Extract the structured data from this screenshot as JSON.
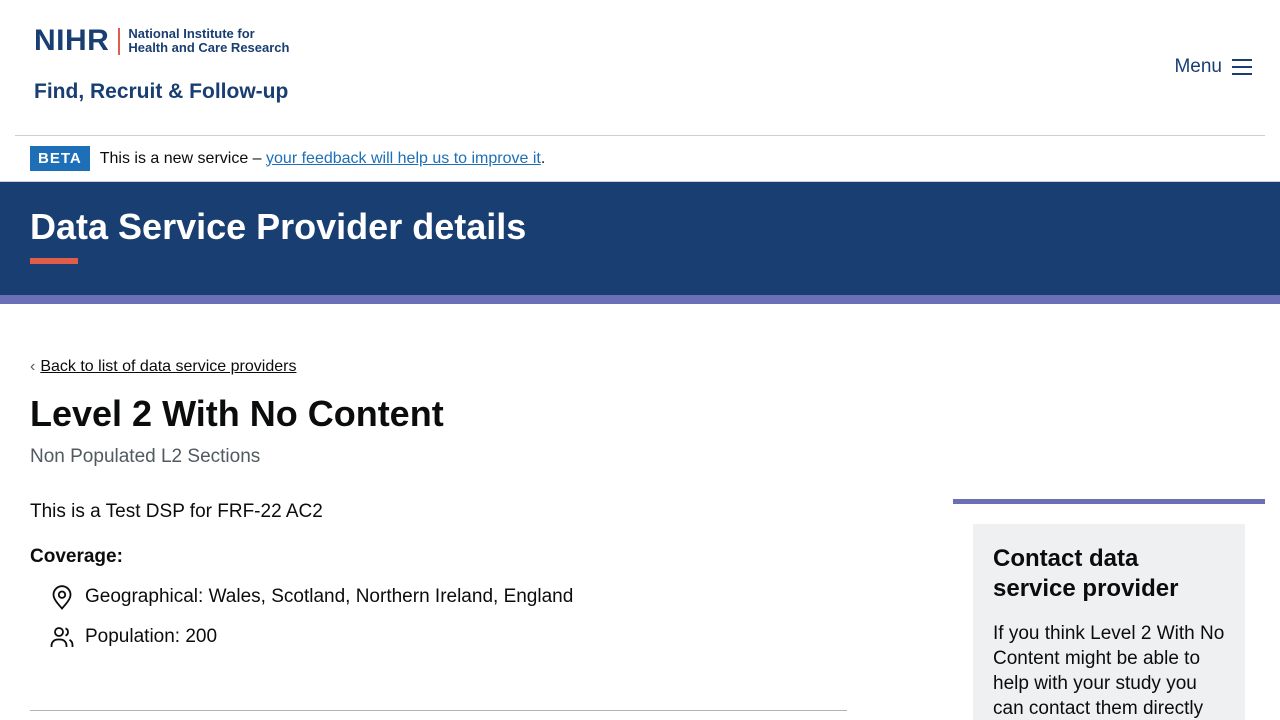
{
  "header": {
    "logo_short": "NIHR",
    "logo_line1": "National Institute for",
    "logo_line2": "Health and Care Research",
    "product_name": "Find, Recruit & Follow-up",
    "menu_label": "Menu"
  },
  "beta_banner": {
    "tag": "BETA",
    "text": "This is a new service –",
    "link": "your feedback will help us to improve it",
    "suffix": "."
  },
  "hero": {
    "title": "Data Service Provider details"
  },
  "main": {
    "back_link": "Back to list of data service providers",
    "title": "Level 2 With No Content",
    "subtitle": "Non Populated L2 Sections",
    "description": "This is a Test DSP for FRF-22 AC2",
    "coverage_label": "Coverage:",
    "coverage": [
      {
        "icon": "map-pin-icon",
        "text": "Geographical: Wales, Scotland, Northern Ireland, England"
      },
      {
        "icon": "people-icon",
        "text": "Population: 200"
      }
    ]
  },
  "sidebar": {
    "heading": "Contact data service provider",
    "body": "If you think Level 2 With No Content might be able to help with your study you can contact them directly"
  },
  "colors": {
    "brand_navy": "#193e72",
    "accent_coral": "#e05c4b",
    "accent_purple": "#6b6fb5",
    "link_blue": "#1d70b8"
  }
}
